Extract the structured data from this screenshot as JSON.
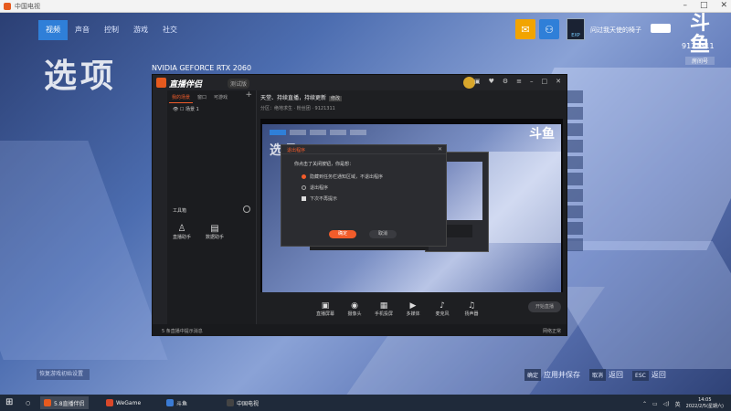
{
  "window": {
    "title": "中国电视"
  },
  "game": {
    "tabs": [
      "视频",
      "声音",
      "控制",
      "游戏",
      "社交"
    ],
    "active_tab": 0,
    "side_title": "选项",
    "gpu": "NVIDIA GEFORCE RTX 2060",
    "user_name": "问过我天使的椅子",
    "room_id": "9121311",
    "bottom_hint": "恢复游戏初始设置",
    "actions": [
      {
        "key": "确定",
        "label": "应用并保存"
      },
      {
        "key": "取消",
        "label": "返回"
      },
      {
        "key": "ESC",
        "label": "返回"
      }
    ]
  },
  "stream_app": {
    "name": "直播伴侣",
    "version": "测试版",
    "tabs": [
      "我的场景",
      "窗口",
      "可游戏"
    ],
    "scene": "场景 1",
    "room_title": "天堂、持续直播，持续更新",
    "room_tag": "修改",
    "room_meta": "分区：绝地求生 · 粉丝团 · 9121311",
    "toolbox_label": "工具箱",
    "tools": [
      {
        "label": "直播助手",
        "icon": "♙"
      },
      {
        "label": "数据助手",
        "icon": "▤"
      }
    ],
    "controls": [
      {
        "label": "直播屏幕",
        "icon": "▣"
      },
      {
        "label": "摄像头",
        "icon": "◉"
      },
      {
        "label": "手机投屏",
        "icon": "▦"
      },
      {
        "label": "多媒体",
        "icon": "▶"
      },
      {
        "label": "麦克风",
        "icon": "♪"
      },
      {
        "label": "扬声器",
        "icon": "♫"
      }
    ],
    "start_label": "开始直播",
    "status_text": "5 条直播中提示消息",
    "status_right": "网络正常",
    "dialog": {
      "title": "退出程序",
      "question": "你点击了关闭按钮，你是想：",
      "option1": "隐藏到任务栏通知区域，不退出程序",
      "option2": "退出程序",
      "remember": "下次不再提示",
      "ok": "确定",
      "cancel": "取消"
    }
  },
  "taskbar": {
    "apps": [
      {
        "label": "5.8直播伴侣",
        "color": "#e65a1e"
      },
      {
        "label": "WeGame",
        "color": "#d9482a"
      },
      {
        "label": "斗鱼",
        "color": "#3a7bd5"
      },
      {
        "label": "中国电视",
        "color": "#444444"
      }
    ],
    "time": "14:05",
    "date": "2022/2/5(星期六)",
    "tray": "英"
  }
}
